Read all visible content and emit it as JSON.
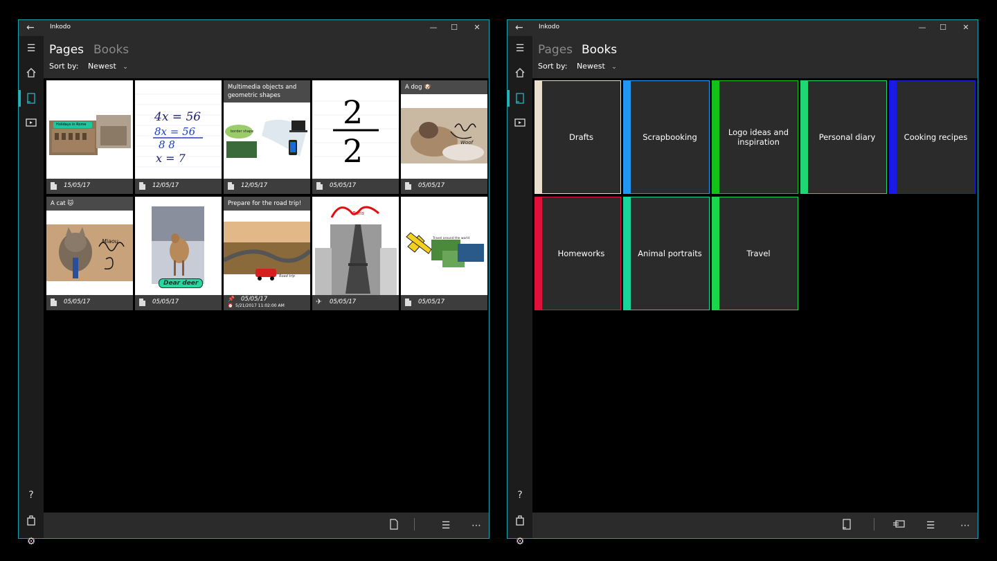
{
  "left_window": {
    "title": "Inkodo",
    "pivots": {
      "pages": "Pages",
      "books": "Books",
      "active": "pages"
    },
    "sort": {
      "label": "Sort by:",
      "value": "Newest"
    },
    "pages": [
      {
        "title": "",
        "date": "15/05/17",
        "thumb_text": "Holidays in Rome"
      },
      {
        "title": "",
        "date": "12/05/17",
        "thumb_text": "4x = 56"
      },
      {
        "title": "Multimedia objects and geometric shapes",
        "date": "12/05/17",
        "thumb_text": "border shape"
      },
      {
        "title": "",
        "date": "05/05/17",
        "thumb_text": "2/2"
      },
      {
        "title": "A dog 🐶",
        "date": "05/05/17",
        "thumb_text": "Woof"
      },
      {
        "title": "A cat 🐱",
        "date": "05/05/17",
        "thumb_text": "Miaou"
      },
      {
        "title": "",
        "date": "05/05/17",
        "thumb_text": "Dear deer"
      },
      {
        "title": "Prepare for the road trip!",
        "date": "05/05/17",
        "reminder": "5/21/2017 11:02:00 AM",
        "thumb_text": "Road trip"
      },
      {
        "title": "",
        "date": "05/05/17",
        "thumb_text": "Paris"
      },
      {
        "title": "",
        "date": "05/05/17",
        "thumb_text": "Travel around the world"
      }
    ]
  },
  "right_window": {
    "title": "Inkodo",
    "pivots": {
      "pages": "Pages",
      "books": "Books",
      "active": "books"
    },
    "sort": {
      "label": "Sort by:",
      "value": "Newest"
    },
    "books": [
      {
        "title": "Drafts",
        "color": "#e8e0cc"
      },
      {
        "title": "Scrapbooking",
        "color": "#2196f3"
      },
      {
        "title": "Logo ideas and inspiration",
        "color": "#12c21a"
      },
      {
        "title": "Personal diary",
        "color": "#1fd673"
      },
      {
        "title": "Cooking recipes",
        "color": "#1a1ae6"
      },
      {
        "title": "Homeworks",
        "color": "#e0103a"
      },
      {
        "title": "Animal portraits",
        "color": "#18d69a"
      },
      {
        "title": "Travel",
        "color": "#1ad64a"
      }
    ]
  },
  "icons": {
    "back": "back-arrow-icon",
    "minimize": "minimize-icon",
    "maximize": "maximize-icon",
    "close": "close-icon",
    "hamburger": "hamburger-menu-icon",
    "home": "home-icon",
    "pages": "page-icon",
    "books": "book-icon",
    "help": "help-icon",
    "store": "shopping-bag-icon",
    "settings": "gear-icon",
    "new_page": "new-page-icon",
    "list": "list-icon",
    "more": "more-icon"
  },
  "colors": {
    "accent": "#1fb6c2",
    "window_border": "#1aa1a9",
    "chrome": "#2b2b2b"
  }
}
